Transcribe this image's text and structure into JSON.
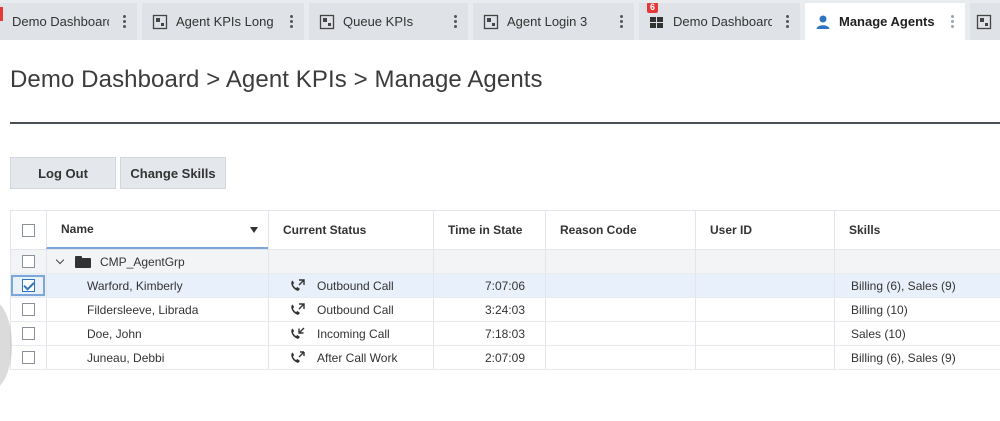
{
  "tabs": [
    {
      "label": "Demo Dashboard :",
      "icon": "none",
      "active": false,
      "badge": ""
    },
    {
      "label": "Agent KPIs Long",
      "icon": "widget-icon",
      "active": false,
      "badge": ""
    },
    {
      "label": "Queue KPIs",
      "icon": "widget-icon",
      "active": false,
      "badge": ""
    },
    {
      "label": "Agent Login 3",
      "icon": "widget-icon",
      "active": false,
      "badge": ""
    },
    {
      "label": "Demo Dashboard",
      "icon": "dashboard-icon",
      "active": false,
      "badge": "6"
    },
    {
      "label": "Manage Agents",
      "icon": "agent-icon",
      "active": true,
      "badge": ""
    }
  ],
  "header": {
    "breadcrumb": "Demo Dashboard > Agent KPIs > Manage Agents"
  },
  "toolbar": {
    "logout_label": "Log Out",
    "change_skills_label": "Change Skills"
  },
  "grid": {
    "columns": {
      "name": "Name",
      "status": "Current Status",
      "time": "Time in State",
      "reason": "Reason Code",
      "user": "User ID",
      "skills": "Skills"
    },
    "group": {
      "label": "CMP_AgentGrp"
    },
    "rows": [
      {
        "name": "Warford, Kimberly",
        "status": "Outbound Call",
        "time": "7:07:06",
        "reason": "",
        "user": "",
        "skills": "Billing (6), Sales (9)",
        "checked": true,
        "icon": "outbound-call-icon"
      },
      {
        "name": "Fildersleeve, Librada",
        "status": "Outbound Call",
        "time": "3:24:03",
        "reason": "",
        "user": "",
        "skills": "Billing (10)",
        "checked": false,
        "icon": "outbound-call-icon"
      },
      {
        "name": "Doe, John",
        "status": "Incoming Call",
        "time": "7:18:03",
        "reason": "",
        "user": "",
        "skills": "Sales (10)",
        "checked": false,
        "icon": "incoming-call-icon"
      },
      {
        "name": "Juneau, Debbi",
        "status": "After Call Work",
        "time": "2:07:09",
        "reason": "",
        "user": "",
        "skills": "Billing (6), Sales (9)",
        "checked": false,
        "icon": "after-call-work-icon"
      }
    ]
  },
  "colors": {
    "accent": "#2f74c0",
    "badge": "#e53935",
    "selected_row": "#e8f0fb"
  }
}
